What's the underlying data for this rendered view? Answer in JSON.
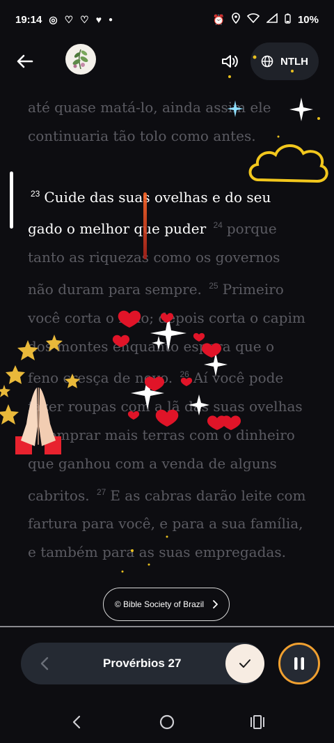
{
  "status_bar": {
    "time": "19:14",
    "battery": "10%",
    "left_icons": [
      "settings-dot-icon",
      "heart-link-icon",
      "heart-link-icon",
      "heart-icon",
      "dot-icon"
    ],
    "right_icons": [
      "alarm-icon",
      "location-icon",
      "wifi-icon",
      "signal-icon",
      "battery-icon"
    ]
  },
  "header": {
    "version_label": "NTLH"
  },
  "reading": {
    "prev_text": "até quase matá-lo, ainda assim ele continuaria tão tolo como antes.",
    "v23_num": "23",
    "v23_text": "Cuide das suas ovelhas e do seu gado o melhor que puder",
    "v24_num": "24",
    "v24_text": "porque tanto as riquezas como os governos não duram para sempre.",
    "v25_num": "25",
    "v25_text": "Primeiro você corta o feno; depois corta o capim dos montes enquanto espera que o feno cresça de novo.",
    "v26_num": "26",
    "v26_text": "Aí você pode fazer roupas com a lã das suas ovelhas e comprar mais terras com o dinheiro que ganhou com a venda de alguns cabritos.",
    "v27_num": "27",
    "v27_text": "E as cabras darão leite com fartura para você, e para a sua família, e também para as suas empregadas."
  },
  "copyright": {
    "label": "© Bible Society of Brazil"
  },
  "player": {
    "chapter": "Provérbios 27"
  },
  "colors": {
    "background": "#0d0d11",
    "dim_text": "#5b5b62",
    "highlight_text": "#ffffff",
    "accent_ring": "#f0a030",
    "check_button": "#f7ece2"
  },
  "decorations": [
    "glowing-cloud",
    "red-hearts",
    "gold-stars",
    "sparkles",
    "praying-hands"
  ]
}
